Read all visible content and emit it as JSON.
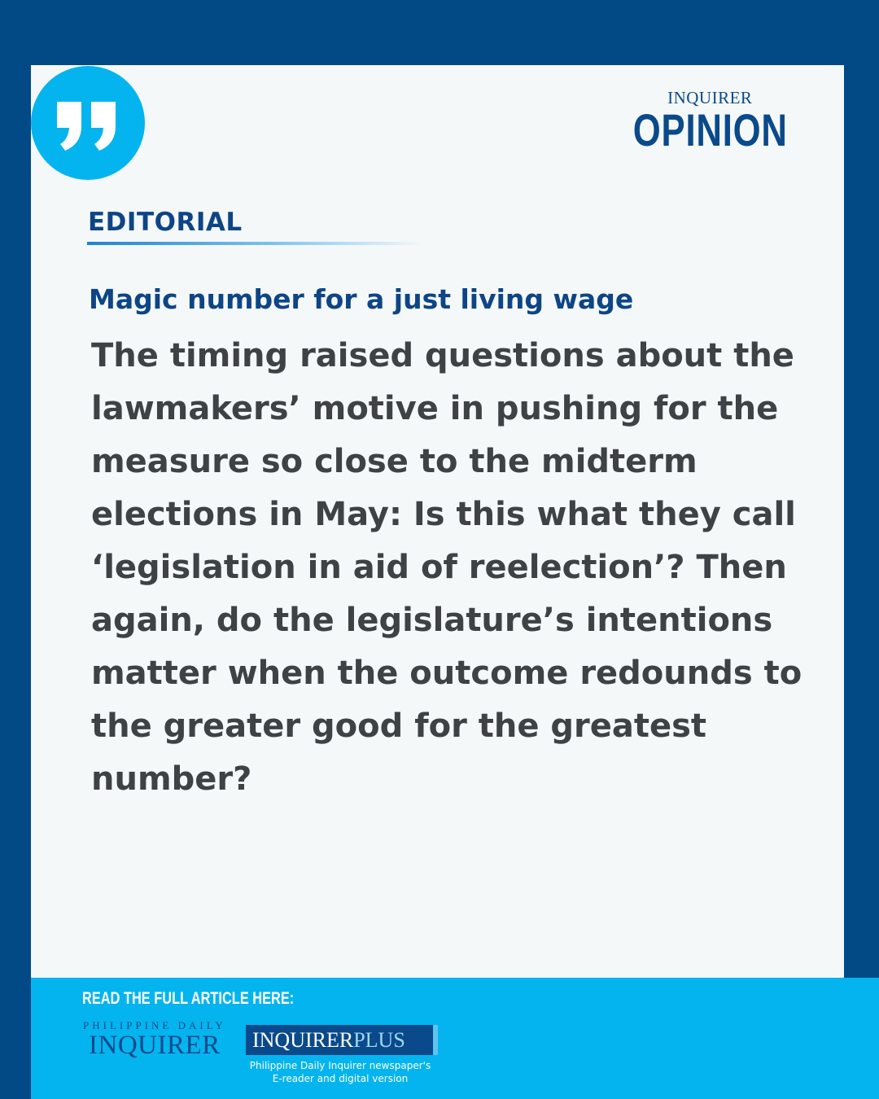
{
  "colors": {
    "frame": "#014a86",
    "card": "#f5f8f9",
    "accent": "#04b4ef",
    "heading": "#0d4586",
    "body_text": "#3f4245"
  },
  "quote_icon": "closing-quote-icon",
  "brand": {
    "top": "INQUIRER",
    "main": "OPINION"
  },
  "section_label": "EDITORIAL",
  "headline": "Magic number for a just living wage",
  "body": "The timing raised questions about the lawmakers’ motive in pushing for the measure so close to the midterm elections in May: Is this what they call ‘legislation in aid of reelection’? Then again, do the legislature’s intentions matter when the outcome redounds to the greater good for the greatest number?",
  "footer": {
    "cta": "READ THE FULL ARTICLE HERE:",
    "pdi_logo": {
      "top": "PHILIPPINE DAILY",
      "main": "INQUIRER"
    },
    "plus_logo": {
      "main": "INQUIRER",
      "suffix": "PLUS"
    },
    "plus_caption_line1": "Philippine Daily Inquirer newspaper's",
    "plus_caption_line2": "E-reader and digital version"
  }
}
